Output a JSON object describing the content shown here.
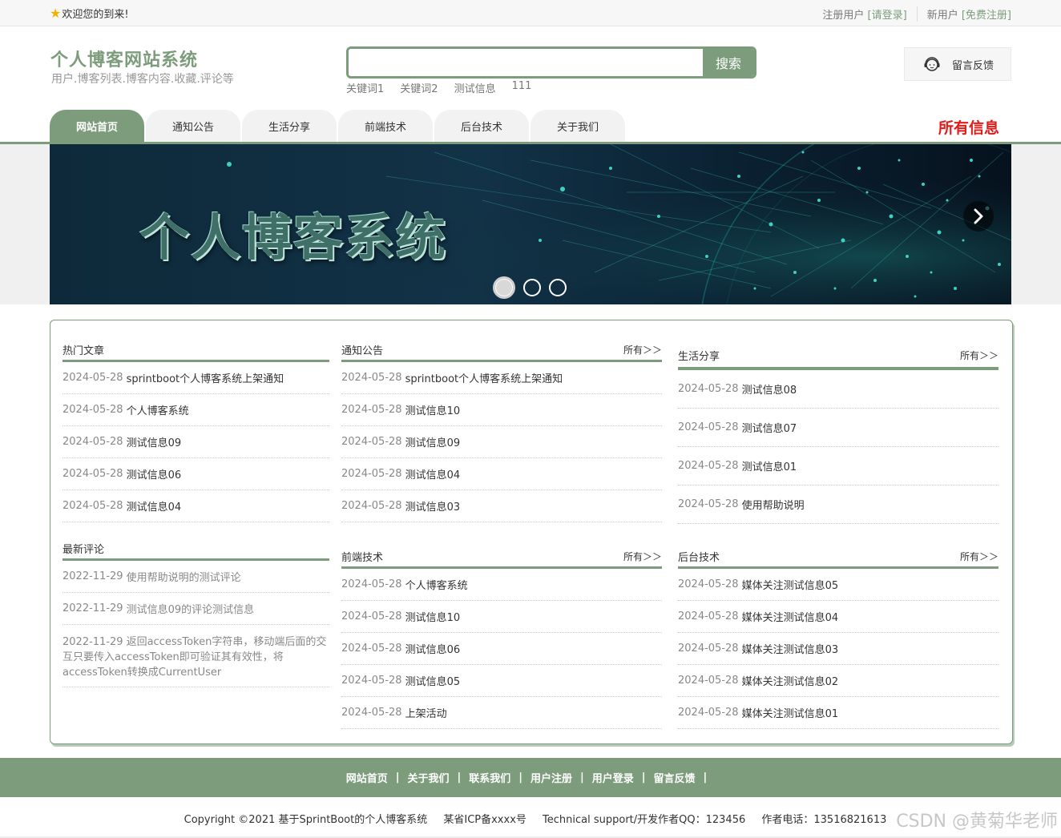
{
  "topbar": {
    "welcome": "欢迎您的到来!",
    "reg_user": "注册用户",
    "login_link": "[请登录]",
    "new_user": "新用户",
    "register_link": "[免费注册]"
  },
  "brand": {
    "title": "个人博客网站系统",
    "subtitle": "用户.博客列表.博客内容.收藏.评论等"
  },
  "search": {
    "placeholder": "",
    "value": "",
    "button": "搜索",
    "keywords": [
      "关键词1",
      "关键词2",
      "测试信息",
      "111"
    ]
  },
  "feedback": {
    "label": "留言反馈",
    "icon": "customer-service-icon"
  },
  "nav": {
    "tabs": [
      "网站首页",
      "通知公告",
      "生活分享",
      "前端技术",
      "后台技术",
      "关于我们"
    ],
    "active_index": 0,
    "all_info": "所有信息"
  },
  "banner": {
    "title": "个人博客系统",
    "slide_count": 3,
    "active_slide": 0
  },
  "colors": {
    "accent": "#7c9c7c",
    "red": "#e21b1b"
  },
  "sections": {
    "hot": {
      "title": "热门文章",
      "items": [
        {
          "date": "2024-05-28",
          "text": "sprintboot个人博客系统上架通知"
        },
        {
          "date": "2024-05-28",
          "text": "个人博客系统"
        },
        {
          "date": "2024-05-28",
          "text": "测试信息09"
        },
        {
          "date": "2024-05-28",
          "text": "测试信息06"
        },
        {
          "date": "2024-05-28",
          "text": "测试信息04"
        }
      ]
    },
    "comments": {
      "title": "最新评论",
      "items": [
        {
          "date": "2022-11-29",
          "text": "使用帮助说明的测试评论"
        },
        {
          "date": "2022-11-29",
          "text": "测试信息09的评论测试信息"
        },
        {
          "date": "2022-11-29",
          "text": "返回accessToken字符串，移动端后面的交互只要传入accessToken即可验证其有效性，将accessToken转换成CurrentUser"
        }
      ]
    },
    "notice": {
      "title": "通知公告",
      "more": "所有＞＞",
      "items": [
        {
          "date": "2024-05-28",
          "text": "sprintboot个人博客系统上架通知"
        },
        {
          "date": "2024-05-28",
          "text": "测试信息10"
        },
        {
          "date": "2024-05-28",
          "text": "测试信息09"
        },
        {
          "date": "2024-05-28",
          "text": "测试信息04"
        },
        {
          "date": "2024-05-28",
          "text": "测试信息03"
        }
      ]
    },
    "frontend": {
      "title": "前端技术",
      "more": "所有＞＞",
      "items": [
        {
          "date": "2024-05-28",
          "text": "个人博客系统"
        },
        {
          "date": "2024-05-28",
          "text": "测试信息10"
        },
        {
          "date": "2024-05-28",
          "text": "测试信息06"
        },
        {
          "date": "2024-05-28",
          "text": "测试信息05"
        },
        {
          "date": "2024-05-28",
          "text": "上架活动"
        }
      ]
    },
    "life": {
      "title": "生活分享",
      "more": "所有＞＞",
      "items": [
        {
          "date": "2024-05-28",
          "text": "测试信息08"
        },
        {
          "date": "2024-05-28",
          "text": "测试信息07"
        },
        {
          "date": "2024-05-28",
          "text": "测试信息01"
        },
        {
          "date": "2024-05-28",
          "text": "使用帮助说明"
        }
      ]
    },
    "backend": {
      "title": "后台技术",
      "more": "所有＞＞",
      "items": [
        {
          "date": "2024-05-28",
          "text": "媒体关注测试信息05"
        },
        {
          "date": "2024-05-28",
          "text": "媒体关注测试信息04"
        },
        {
          "date": "2024-05-28",
          "text": "媒体关注测试信息03"
        },
        {
          "date": "2024-05-28",
          "text": "媒体关注测试信息02"
        },
        {
          "date": "2024-05-28",
          "text": "媒体关注测试信息01"
        }
      ]
    }
  },
  "footer": {
    "links": [
      "网站首页",
      "关于我们",
      "联系我们",
      "用户注册",
      "用户登录",
      "留言反馈"
    ],
    "separator": "|",
    "copyright": "Copyright ©2021 基于SprintBoot的个人博客系统",
    "icp": "某省ICP备xxxx号",
    "support": "Technical support/开发作者QQ：123456",
    "phone": "作者电话：13516821613",
    "watermark": "CSDN @黄菊华老师"
  }
}
